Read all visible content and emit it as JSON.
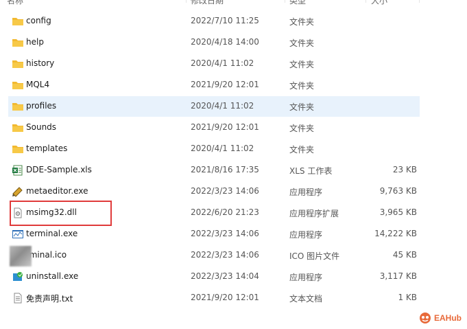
{
  "header": {
    "columns": [
      {
        "label": "名称"
      },
      {
        "label": "修改日期"
      },
      {
        "label": "类型"
      },
      {
        "label": "大小"
      }
    ]
  },
  "files": [
    {
      "name": "config",
      "date": "2022/7/10 11:25",
      "type": "文件夹",
      "size": "",
      "icon": "folder-icon"
    },
    {
      "name": "help",
      "date": "2020/4/18 14:00",
      "type": "文件夹",
      "size": "",
      "icon": "folder-icon"
    },
    {
      "name": "history",
      "date": "2020/4/1 11:02",
      "type": "文件夹",
      "size": "",
      "icon": "folder-icon"
    },
    {
      "name": "MQL4",
      "date": "2021/9/20 12:01",
      "type": "文件夹",
      "size": "",
      "icon": "folder-icon"
    },
    {
      "name": "profiles",
      "date": "2020/4/1 11:02",
      "type": "文件夹",
      "size": "",
      "icon": "folder-icon",
      "selected": true
    },
    {
      "name": "Sounds",
      "date": "2021/9/20 12:01",
      "type": "文件夹",
      "size": "",
      "icon": "folder-icon"
    },
    {
      "name": "templates",
      "date": "2020/4/1 11:02",
      "type": "文件夹",
      "size": "",
      "icon": "folder-icon"
    },
    {
      "name": "DDE-Sample.xls",
      "date": "2021/8/16 17:35",
      "type": "XLS 工作表",
      "size": "23 KB",
      "icon": "spreadsheet-icon"
    },
    {
      "name": "metaeditor.exe",
      "date": "2022/3/23 14:06",
      "type": "应用程序",
      "size": "9,763 KB",
      "icon": "metaeditor-icon"
    },
    {
      "name": "msimg32.dll",
      "date": "2022/6/20 21:23",
      "type": "应用程序扩展",
      "size": "3,965 KB",
      "icon": "dll-file-icon"
    },
    {
      "name": "terminal.exe",
      "date": "2022/3/23 14:06",
      "type": "应用程序",
      "size": "14,222 KB",
      "icon": "terminal-app-icon"
    },
    {
      "name": "rminal.ico",
      "date": "2022/3/23 14:06",
      "type": "ICO 图片文件",
      "size": "45 KB",
      "icon": "ico-file-icon"
    },
    {
      "name": "uninstall.exe",
      "date": "2022/3/23 14:04",
      "type": "应用程序",
      "size": "3,117 KB",
      "icon": "uninstall-icon"
    },
    {
      "name": "免责声明.txt",
      "date": "2021/9/20 12:01",
      "type": "文本文档",
      "size": "1 KB",
      "icon": "text-file-icon"
    }
  ],
  "watermark": {
    "text": "EAHub"
  },
  "colors": {
    "folder": "#f7c948",
    "selection": "#e8f2fc",
    "highlight_box": "#e03a3a",
    "watermark": "#e86a3a"
  }
}
